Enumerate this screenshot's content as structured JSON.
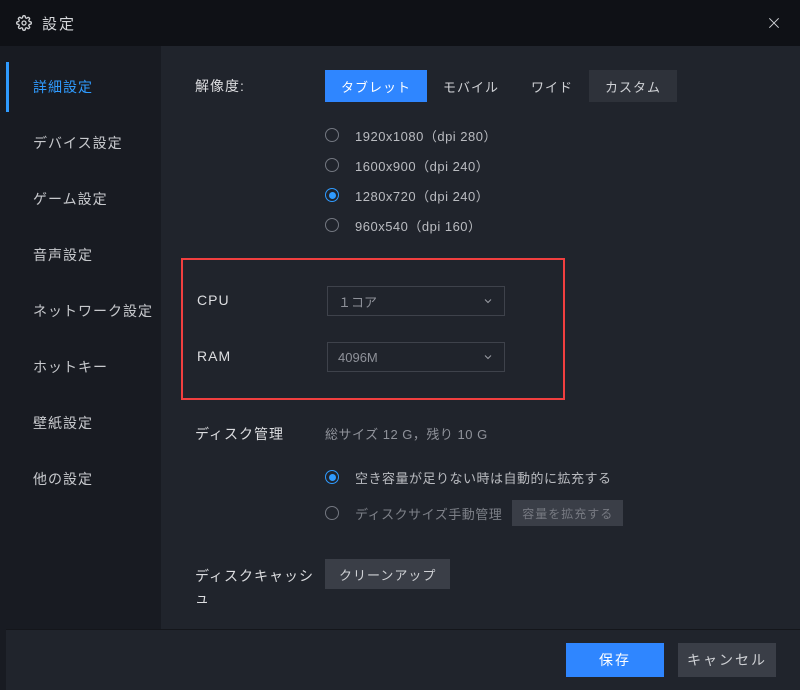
{
  "window": {
    "title": "設定"
  },
  "sidebar": {
    "items": [
      {
        "label": "詳細設定",
        "active": true
      },
      {
        "label": "デバイス設定",
        "active": false
      },
      {
        "label": "ゲーム設定",
        "active": false
      },
      {
        "label": "音声設定",
        "active": false
      },
      {
        "label": "ネットワーク設定",
        "active": false
      },
      {
        "label": "ホットキー",
        "active": false
      },
      {
        "label": "壁紙設定",
        "active": false
      },
      {
        "label": "他の設定",
        "active": false
      }
    ]
  },
  "resolution": {
    "label": "解像度:",
    "tabs": [
      {
        "label": "タブレット",
        "active": true
      },
      {
        "label": "モバイル",
        "active": false
      },
      {
        "label": "ワイド",
        "active": false
      },
      {
        "label": "カスタム",
        "active": false
      }
    ],
    "options": [
      {
        "label": "1920x1080（dpi 280）",
        "selected": false
      },
      {
        "label": "1600x900（dpi 240）",
        "selected": false
      },
      {
        "label": "1280x720（dpi 240）",
        "selected": true
      },
      {
        "label": "960x540（dpi 160）",
        "selected": false
      }
    ]
  },
  "cpu": {
    "label": "CPU",
    "value": "１コア"
  },
  "ram": {
    "label": "RAM",
    "value": "4096M"
  },
  "disk": {
    "label": "ディスク管理",
    "summary": "総サイズ 12 G，残り 10 G",
    "options": [
      {
        "label": "空き容量が足りない時は自動的に拡充する",
        "selected": true
      },
      {
        "label": "ディスクサイズ手動管理",
        "selected": false,
        "button": "容量を拡充する"
      }
    ]
  },
  "cache": {
    "label": "ディスクキャッシュ",
    "button": "クリーンアップ"
  },
  "footer": {
    "save": "保存",
    "cancel": "キャンセル"
  }
}
